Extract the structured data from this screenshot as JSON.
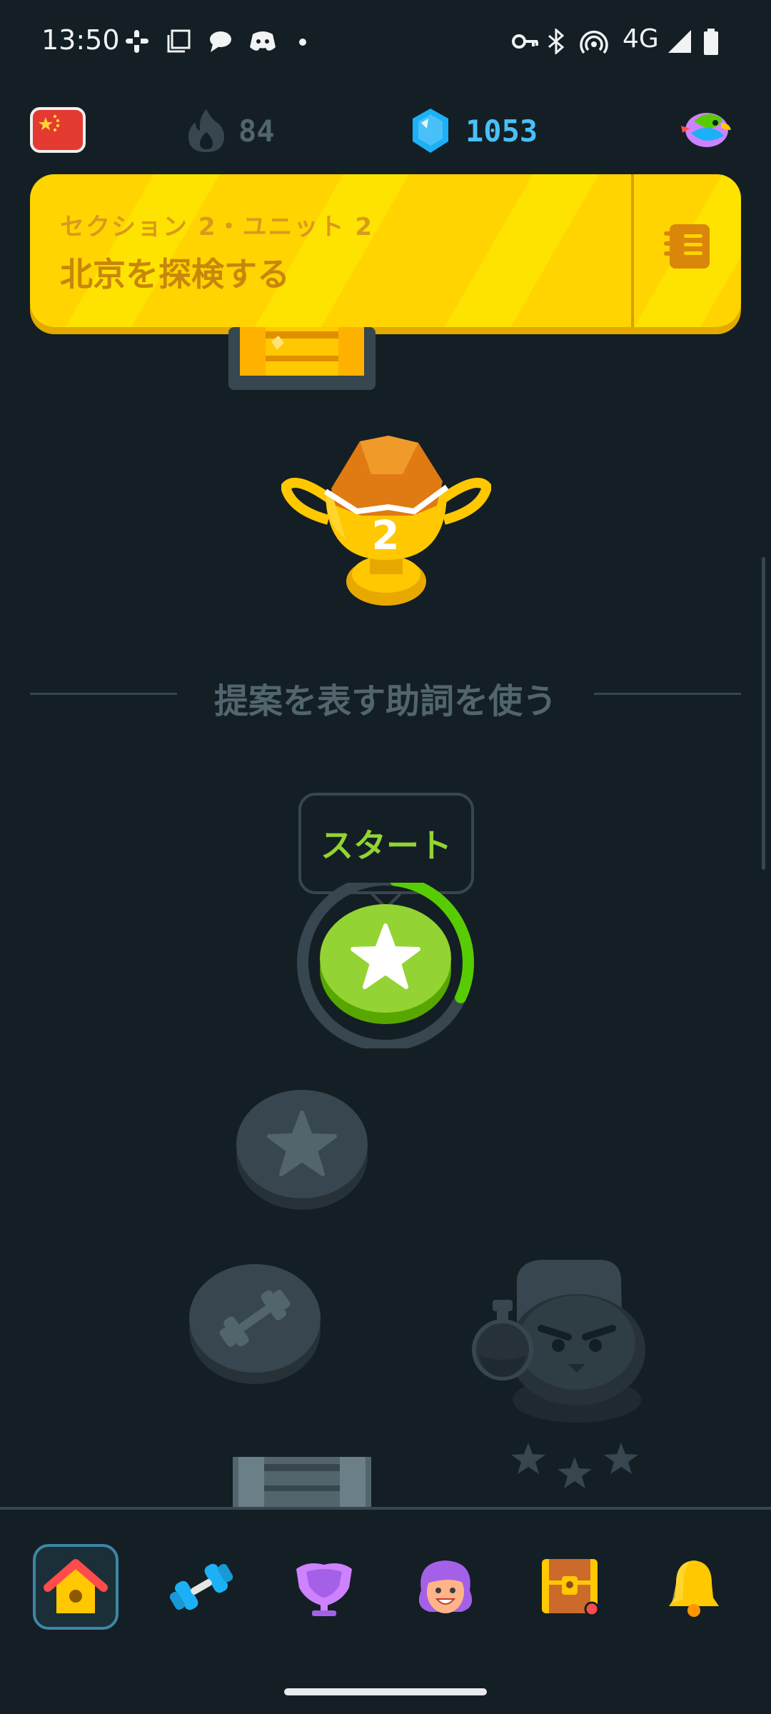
{
  "status_bar": {
    "time": "13:50",
    "network": "4G",
    "icons": [
      "slack-icon",
      "copy-icon",
      "chat-bubble-icon",
      "discord-icon",
      "dot-icon",
      "vpn-key-icon",
      "bluetooth-icon",
      "hotspot-icon",
      "signal-icon",
      "battery-icon"
    ]
  },
  "top_stats": {
    "course_flag": "china-flag-icon",
    "streak_count": "84",
    "gems_count": "1053",
    "profile_icon": "colorful-bird-avatar-icon"
  },
  "banner": {
    "subtitle": "セクション 2・ユニット 2",
    "title": "北京を探検する",
    "guidebook_icon": "guidebook-icon"
  },
  "path": {
    "trophy_number": "2",
    "unit_title": "提案を表す助詞を使う",
    "start_label": "スタート",
    "start_progress": 0.3,
    "character_stars": 3
  },
  "colors": {
    "background": "#131f24",
    "green": "#93d333",
    "yellow": "#ffd400",
    "gem_blue": "#49c0f8",
    "locked_gray": "#37464f"
  },
  "nav": {
    "items": [
      "home-icon",
      "practice-dumbbell-icon",
      "leaderboard-icon",
      "profile-icon",
      "treasure-chest-icon",
      "bell-icon"
    ],
    "selected": 0
  }
}
